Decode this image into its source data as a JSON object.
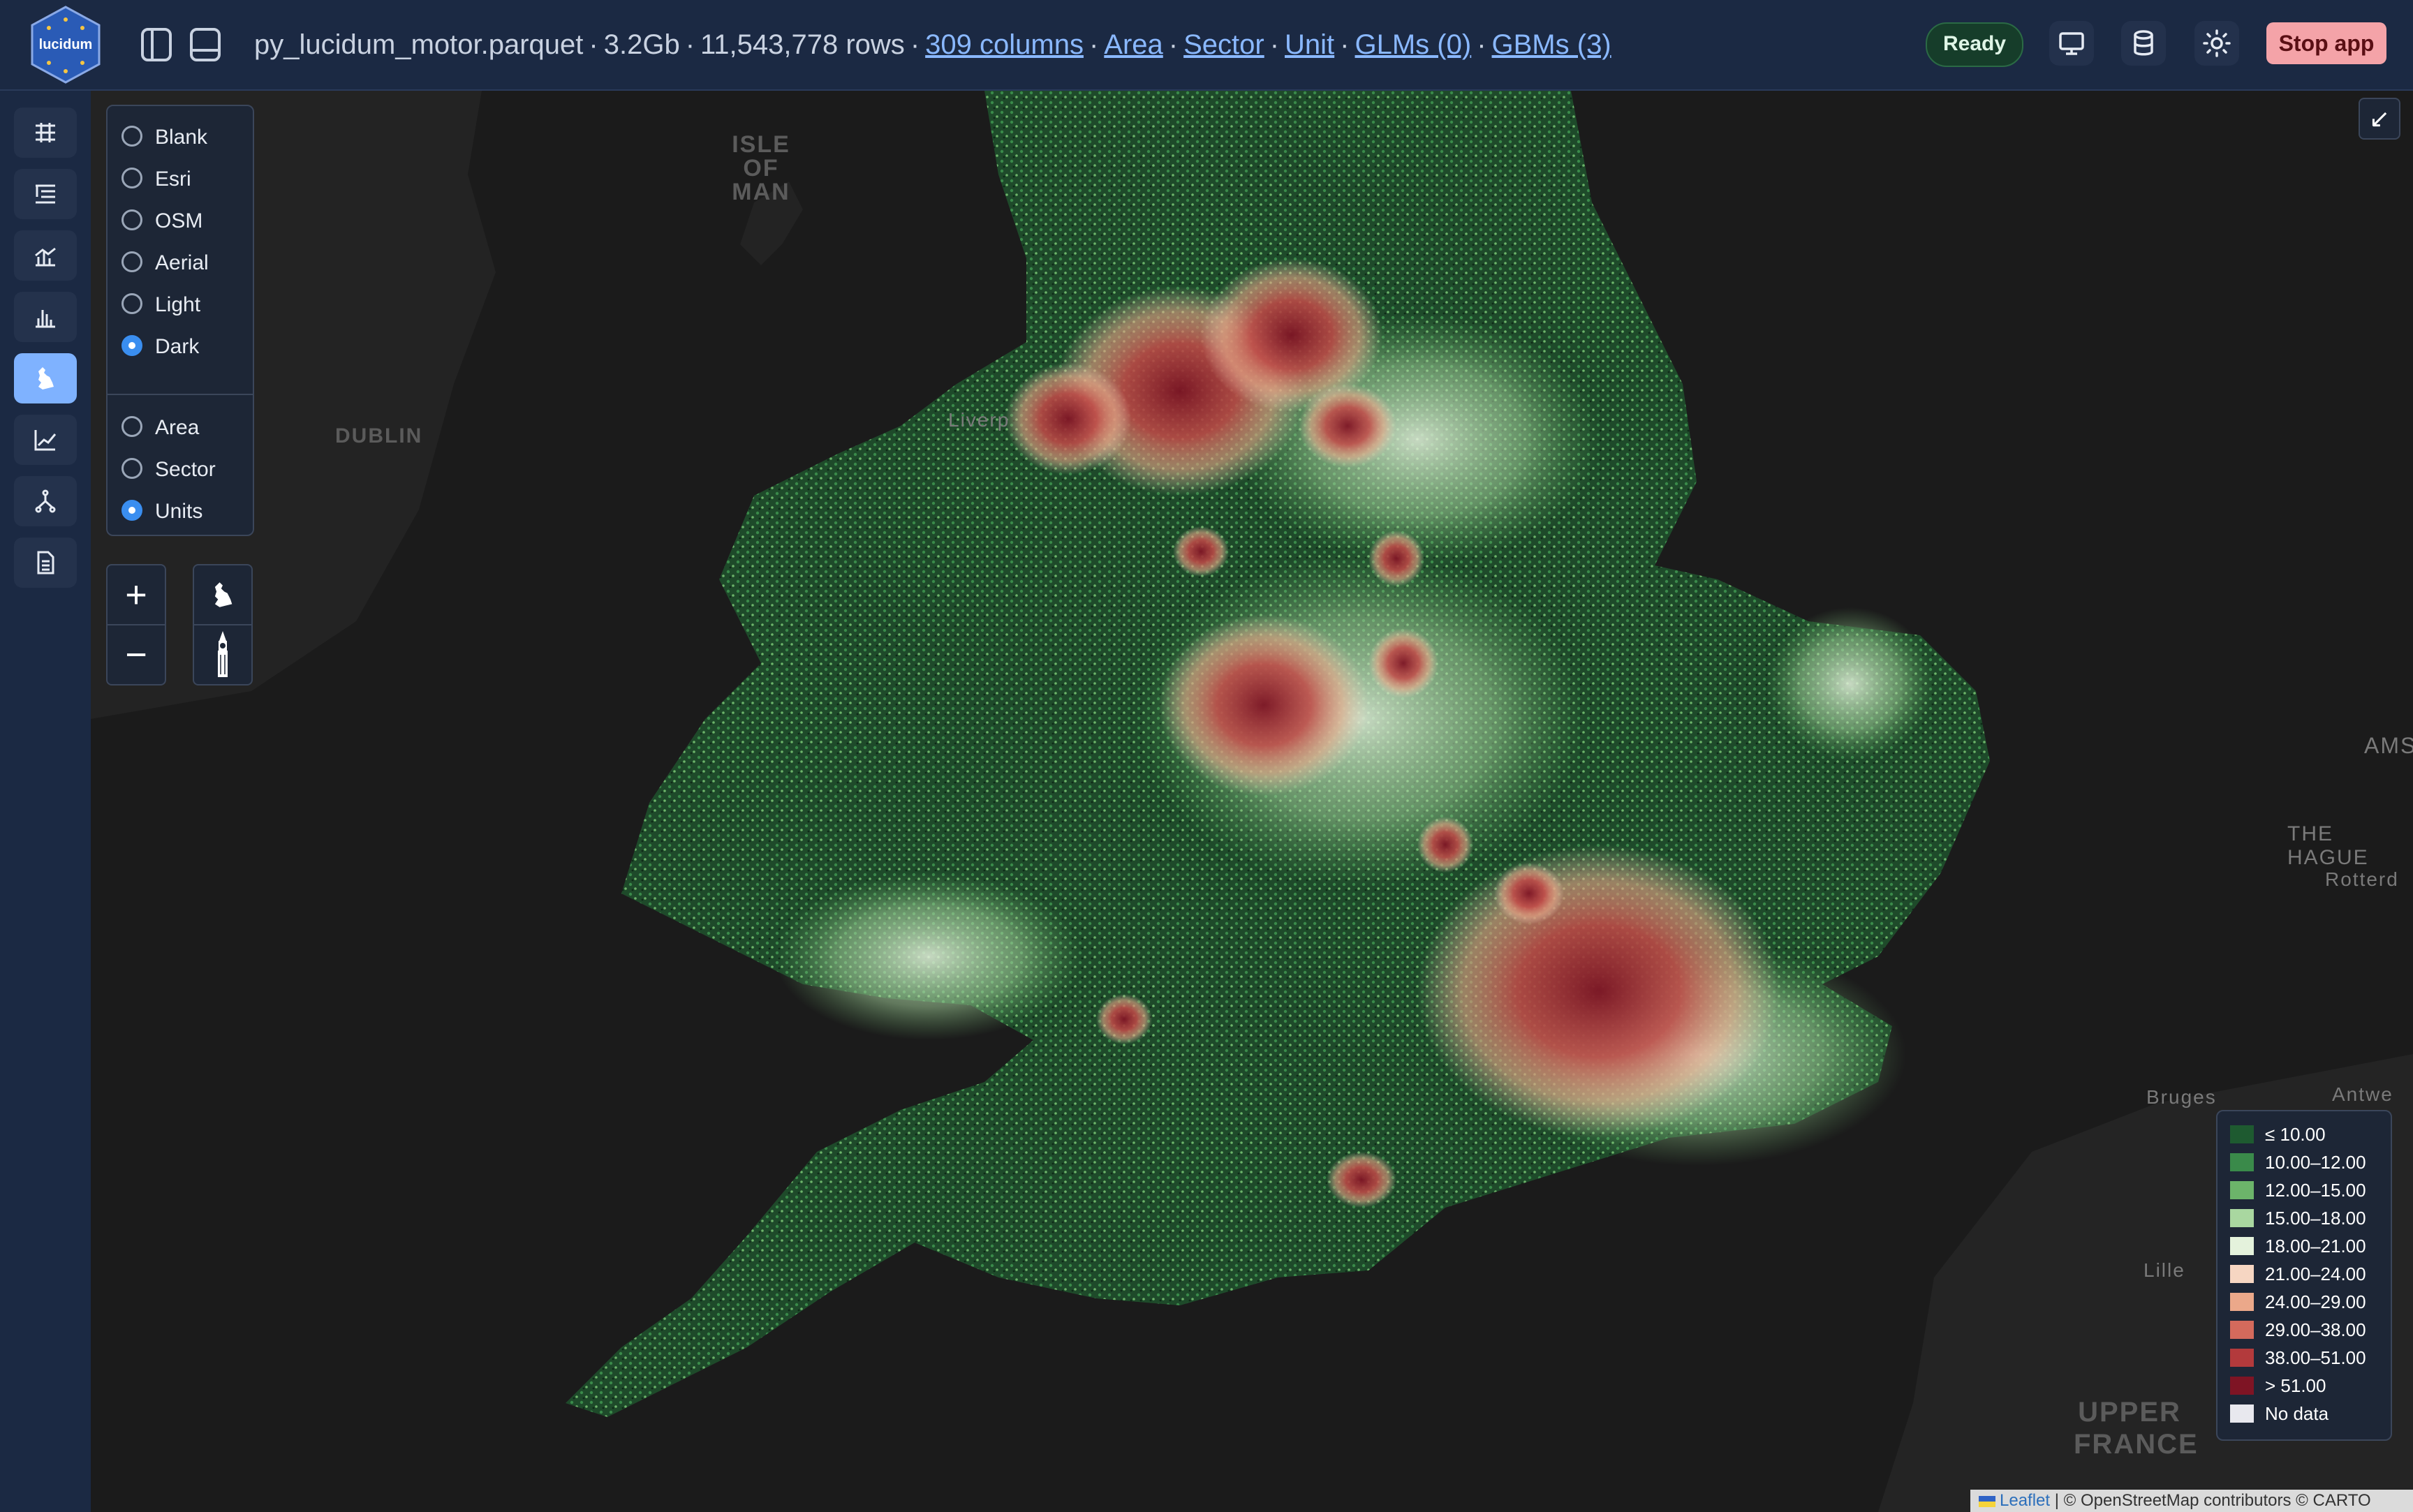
{
  "header": {
    "logo_text": "lucidum",
    "dataset": "py_lucidum_motor.parquet",
    "size": "3.2Gb",
    "rows": "11,543,778 rows",
    "sep": "·",
    "links": {
      "columns": "309 columns",
      "area": "Area",
      "sector": "Sector",
      "unit": "Unit",
      "glms": "GLMs (0)",
      "gbms": "GBMs (3)"
    },
    "status": "Ready",
    "stop_label": "Stop app"
  },
  "sidebar": {
    "items": [
      {
        "name": "table-icon"
      },
      {
        "name": "list-icon"
      },
      {
        "name": "bar-line-chart-icon"
      },
      {
        "name": "histogram-icon"
      },
      {
        "name": "uk-map-icon",
        "active": true
      },
      {
        "name": "line-chart-icon"
      },
      {
        "name": "tree-icon"
      },
      {
        "name": "document-icon"
      }
    ]
  },
  "map": {
    "basemap_options": [
      "Blank",
      "Esri",
      "OSM",
      "Aerial",
      "Light",
      "Dark"
    ],
    "basemap_selected": "Dark",
    "level_options": [
      "Area",
      "Sector",
      "Units"
    ],
    "level_selected": "Units",
    "zoom_in": "+",
    "zoom_out": "−",
    "collapse_icon": "↙",
    "place_labels": {
      "isle1": "ISLE",
      "isle2": "OF",
      "isle3": "MAN",
      "dublin": "DUBLIN",
      "liverpool": "Liverp",
      "hague": "THE HAGUE",
      "rotterdam": "Rotterd",
      "ams": "AMS",
      "bruges": "Bruges",
      "antwerp": "Antwe",
      "lille": "Lille",
      "upper": "UPPER",
      "france": "FRANCE"
    },
    "legend": [
      {
        "label": "≤ 10.00",
        "color": "#1e5a30"
      },
      {
        "label": "10.00–12.00",
        "color": "#3a8a4a"
      },
      {
        "label": "12.00–15.00",
        "color": "#6cb46a"
      },
      {
        "label": "15.00–18.00",
        "color": "#a9d7a0"
      },
      {
        "label": "18.00–21.00",
        "color": "#e4f2dc"
      },
      {
        "label": "21.00–24.00",
        "color": "#f6d6c2"
      },
      {
        "label": "24.00–29.00",
        "color": "#eba88a"
      },
      {
        "label": "29.00–38.00",
        "color": "#d46a5c"
      },
      {
        "label": "38.00–51.00",
        "color": "#b33a3c"
      },
      {
        "label": "> 51.00",
        "color": "#7e1424"
      },
      {
        "label": "No data",
        "color": "#e8e8ee"
      }
    ],
    "attribution_leaflet": "Leaflet",
    "attribution_rest": " | © OpenStreetMap contributors © CARTO"
  }
}
